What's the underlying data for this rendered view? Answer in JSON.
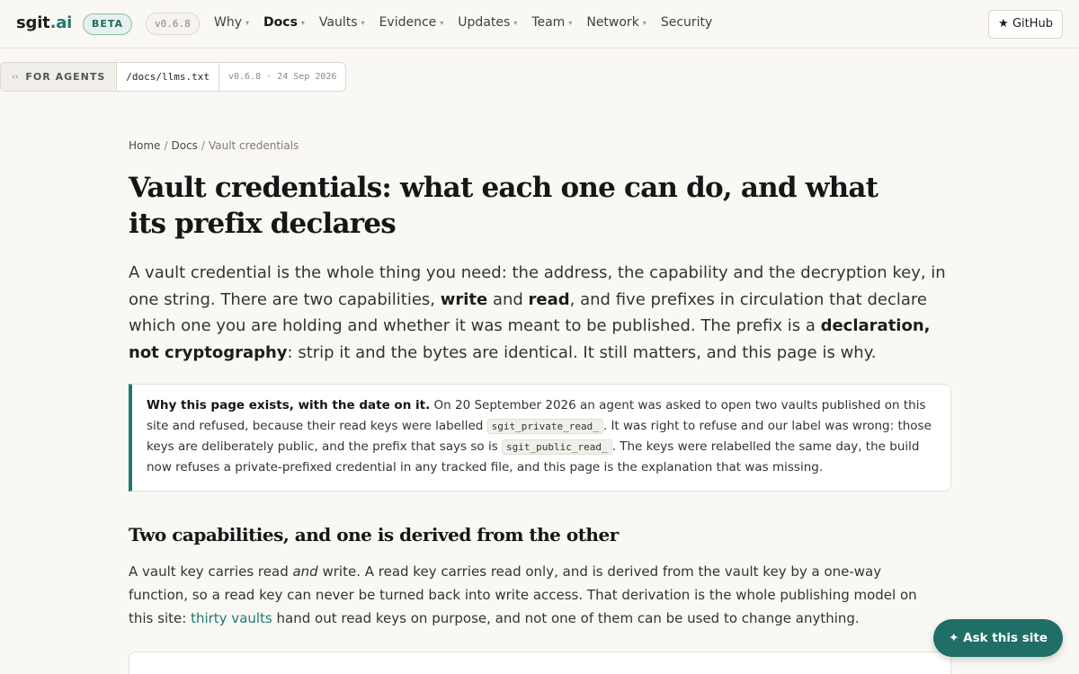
{
  "brand": {
    "name": "sgit",
    "suffix": ".ai"
  },
  "badge": {
    "beta": "BETA",
    "version": "v0.6.8"
  },
  "nav": {
    "items": [
      {
        "label": "Why",
        "has_caret": true
      },
      {
        "label": "Docs",
        "has_caret": true,
        "active": true
      },
      {
        "label": "Vaults",
        "has_caret": true
      },
      {
        "label": "Evidence",
        "has_caret": true
      },
      {
        "label": "Updates",
        "has_caret": true
      },
      {
        "label": "Team",
        "has_caret": true
      },
      {
        "label": "Network",
        "has_caret": true
      },
      {
        "label": "Security",
        "has_caret": false
      }
    ],
    "caret_glyph": "▾",
    "github": "★ GitHub"
  },
  "agents_bar": {
    "icon": "‹›",
    "label": "FOR AGENTS",
    "path": "/docs/llms.txt",
    "meta": "v0.6.8 · 24 Sep 2026"
  },
  "breadcrumb": {
    "home": "Home",
    "docs": "Docs",
    "current": "Vault credentials",
    "sep": "/"
  },
  "page": {
    "title": "Vault credentials: what each one can do, and what its prefix declares",
    "lede": {
      "p1": "A vault credential is the whole thing you need: the address, the capability and the decryption key, in one string. There are two capabilities, ",
      "b1": "write",
      "p2": " and ",
      "b2": "read",
      "p3": ", and five prefixes in circulation that declare which one you are holding and whether it was meant to be published. The prefix is a ",
      "b3": "declaration, not cryptography",
      "p4": ": strip it and the bytes are identical. It still matters, and this page is why."
    },
    "callout": {
      "bold": "Why this page exists, with the date on it.",
      "t1": " On 20 September 2026 an agent was asked to open two vaults published on this site and refused, because their read keys were labelled ",
      "code1": "sgit_private_read_",
      "t2": ". It was right to refuse and our label was wrong: those keys are deliberately public, and the prefix that says so is ",
      "code2": "sgit_public_read_",
      "t3": ". The keys were relabelled the same day, the build now refuses a private-prefixed credential in any tracked file, and this page is the explanation that was missing."
    },
    "section1": {
      "heading": "Two capabilities, and one is derived from the other",
      "t1": "A vault key carries read ",
      "em": "and",
      "t2": " write. A read key carries read only, and is derived from the vault key by a one-way function, so a read key can never be turned back into write access. That derivation is the whole publishing model on this site: ",
      "link": "thirty vaults",
      "t3": " hand out read keys on purpose, and not one of them can be used to change anything."
    }
  },
  "ask_button": "✦ Ask this site",
  "colors": {
    "accent": "#1f7a6e",
    "background": "#faf8f4"
  }
}
